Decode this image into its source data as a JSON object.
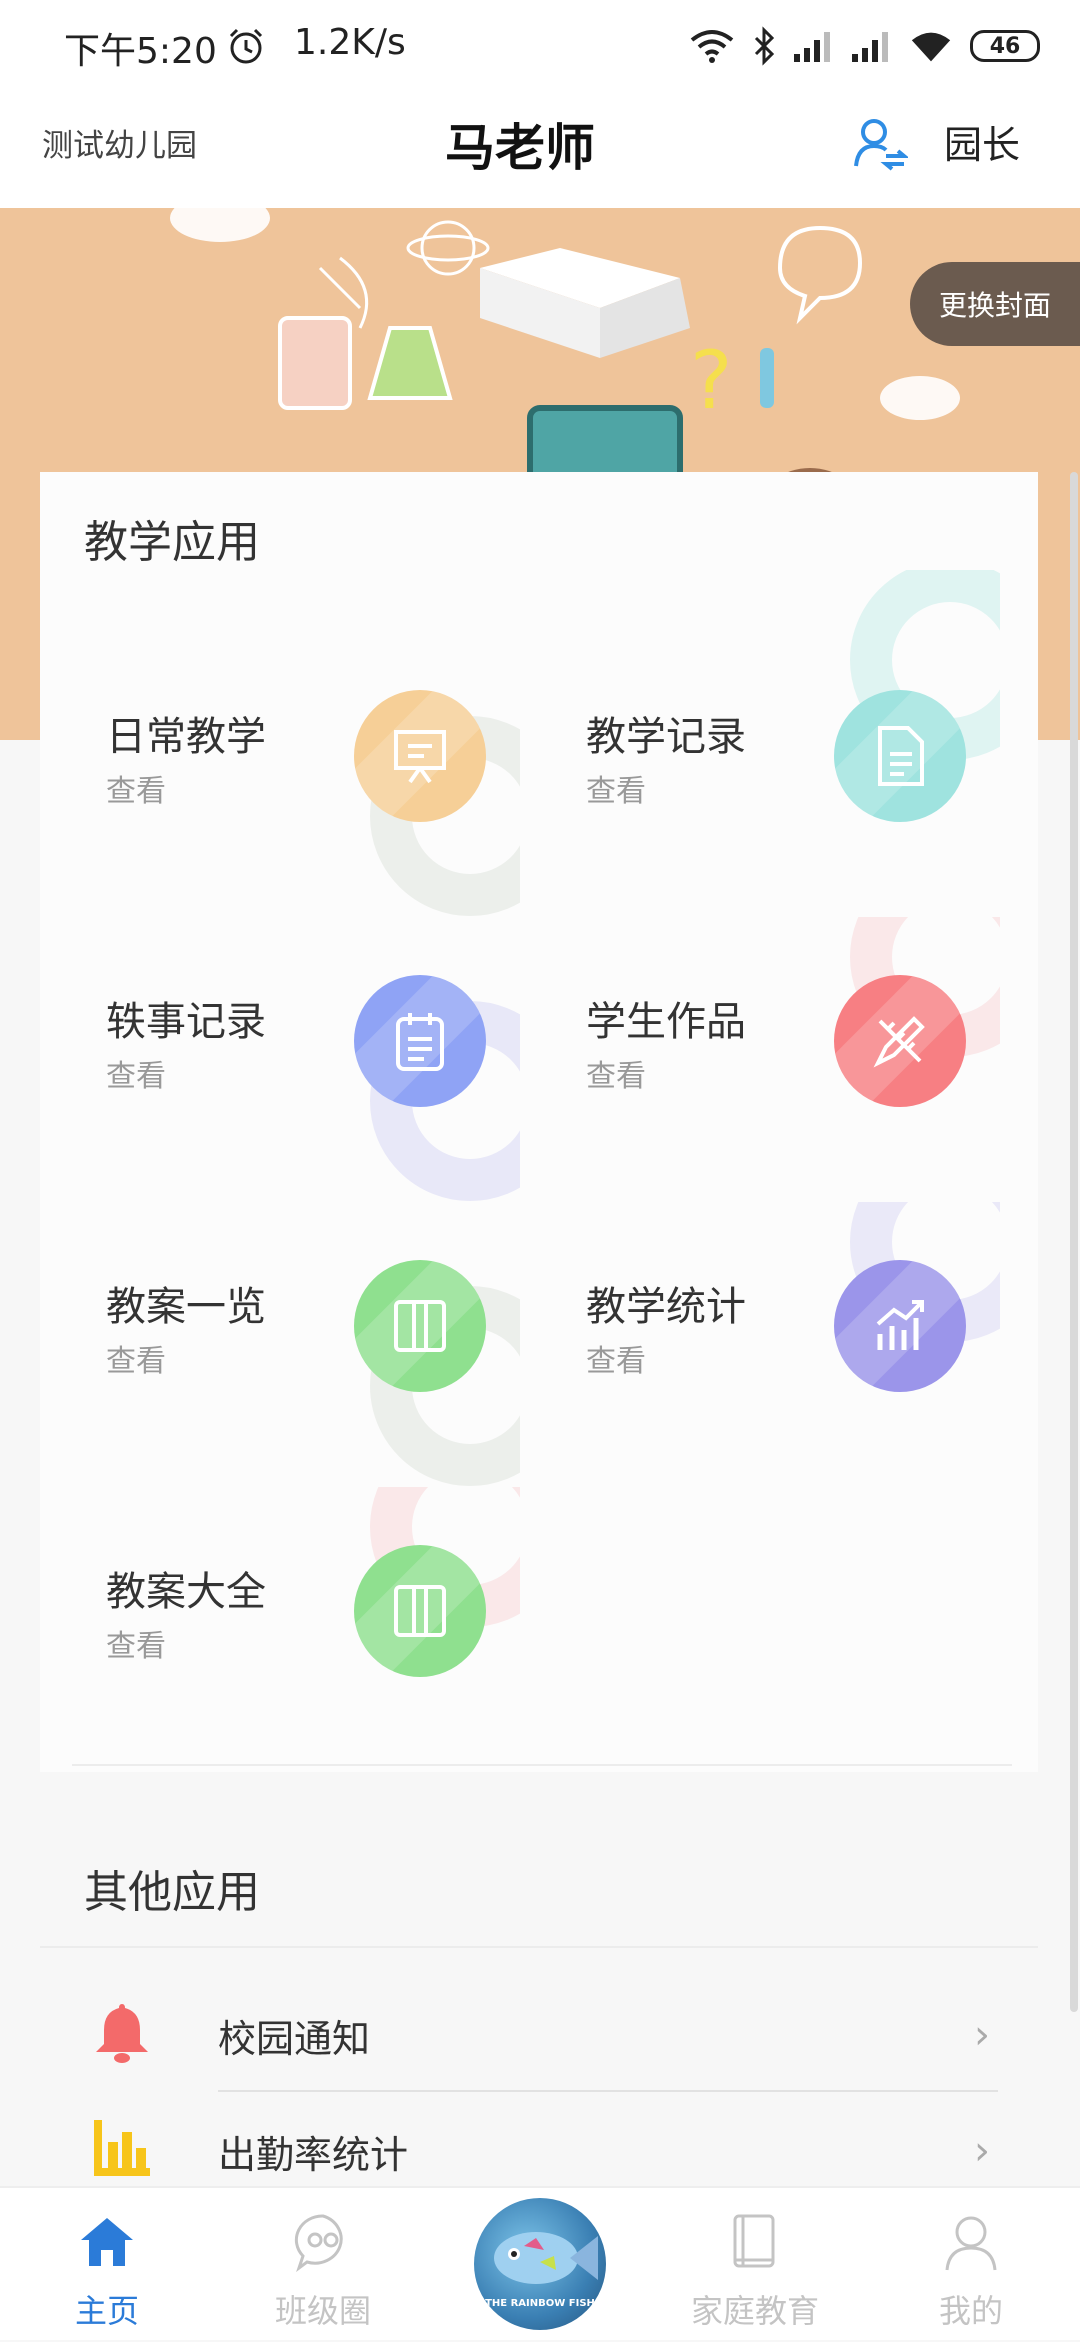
{
  "status_bar": {
    "time": "下午5:20",
    "net_speed": "1.2K/s",
    "battery": "46"
  },
  "header": {
    "kindergarten": "测试幼儿园",
    "teacher_name": "马老师",
    "role": "园长"
  },
  "banner": {
    "change_cover": "更换封面"
  },
  "teaching_apps": {
    "title": "教学应用",
    "items": [
      {
        "name": "日常教学",
        "sub": "查看",
        "icon": "presentation-board-icon",
        "color": "#f6cf97",
        "deco": "#cfd7cc"
      },
      {
        "name": "教学记录",
        "sub": "查看",
        "icon": "document-icon",
        "color": "#9fe3df",
        "deco": "#a9e6df"
      },
      {
        "name": "轶事记录",
        "sub": "查看",
        "icon": "clipboard-icon",
        "color": "#8fa3f5",
        "deco": "#c2c2f0"
      },
      {
        "name": "学生作品",
        "sub": "查看",
        "icon": "pencil-ruler-icon",
        "color": "#f77f83",
        "deco": "#f6c3c6"
      },
      {
        "name": "教案一览",
        "sub": "查看",
        "icon": "open-book-icon",
        "color": "#8fe08f",
        "deco": "#cfd7cc"
      },
      {
        "name": "教学统计",
        "sub": "查看",
        "icon": "bar-chart-icon",
        "color": "#9b95ea",
        "deco": "#c8c5f2"
      },
      {
        "name": "教案大全",
        "sub": "查看",
        "icon": "open-book-icon",
        "color": "#8fe08f",
        "deco": "#f6c3c6"
      }
    ]
  },
  "other_apps": {
    "title": "其他应用",
    "items": [
      {
        "label": "校园通知",
        "icon": "bell-icon",
        "color": "#f36a6a"
      },
      {
        "label": "出勤率统计",
        "icon": "bar-chart-icon",
        "color": "#f7c51a"
      }
    ]
  },
  "bottom_nav": {
    "items": [
      {
        "label": "主页",
        "icon": "home-icon"
      },
      {
        "label": "班级圈",
        "icon": "chat-bubble-icon"
      },
      {
        "label": "家庭教育",
        "icon": "book-icon"
      },
      {
        "label": "我的",
        "icon": "user-icon"
      }
    ],
    "center_text": "THE RAINBOW FISH"
  }
}
